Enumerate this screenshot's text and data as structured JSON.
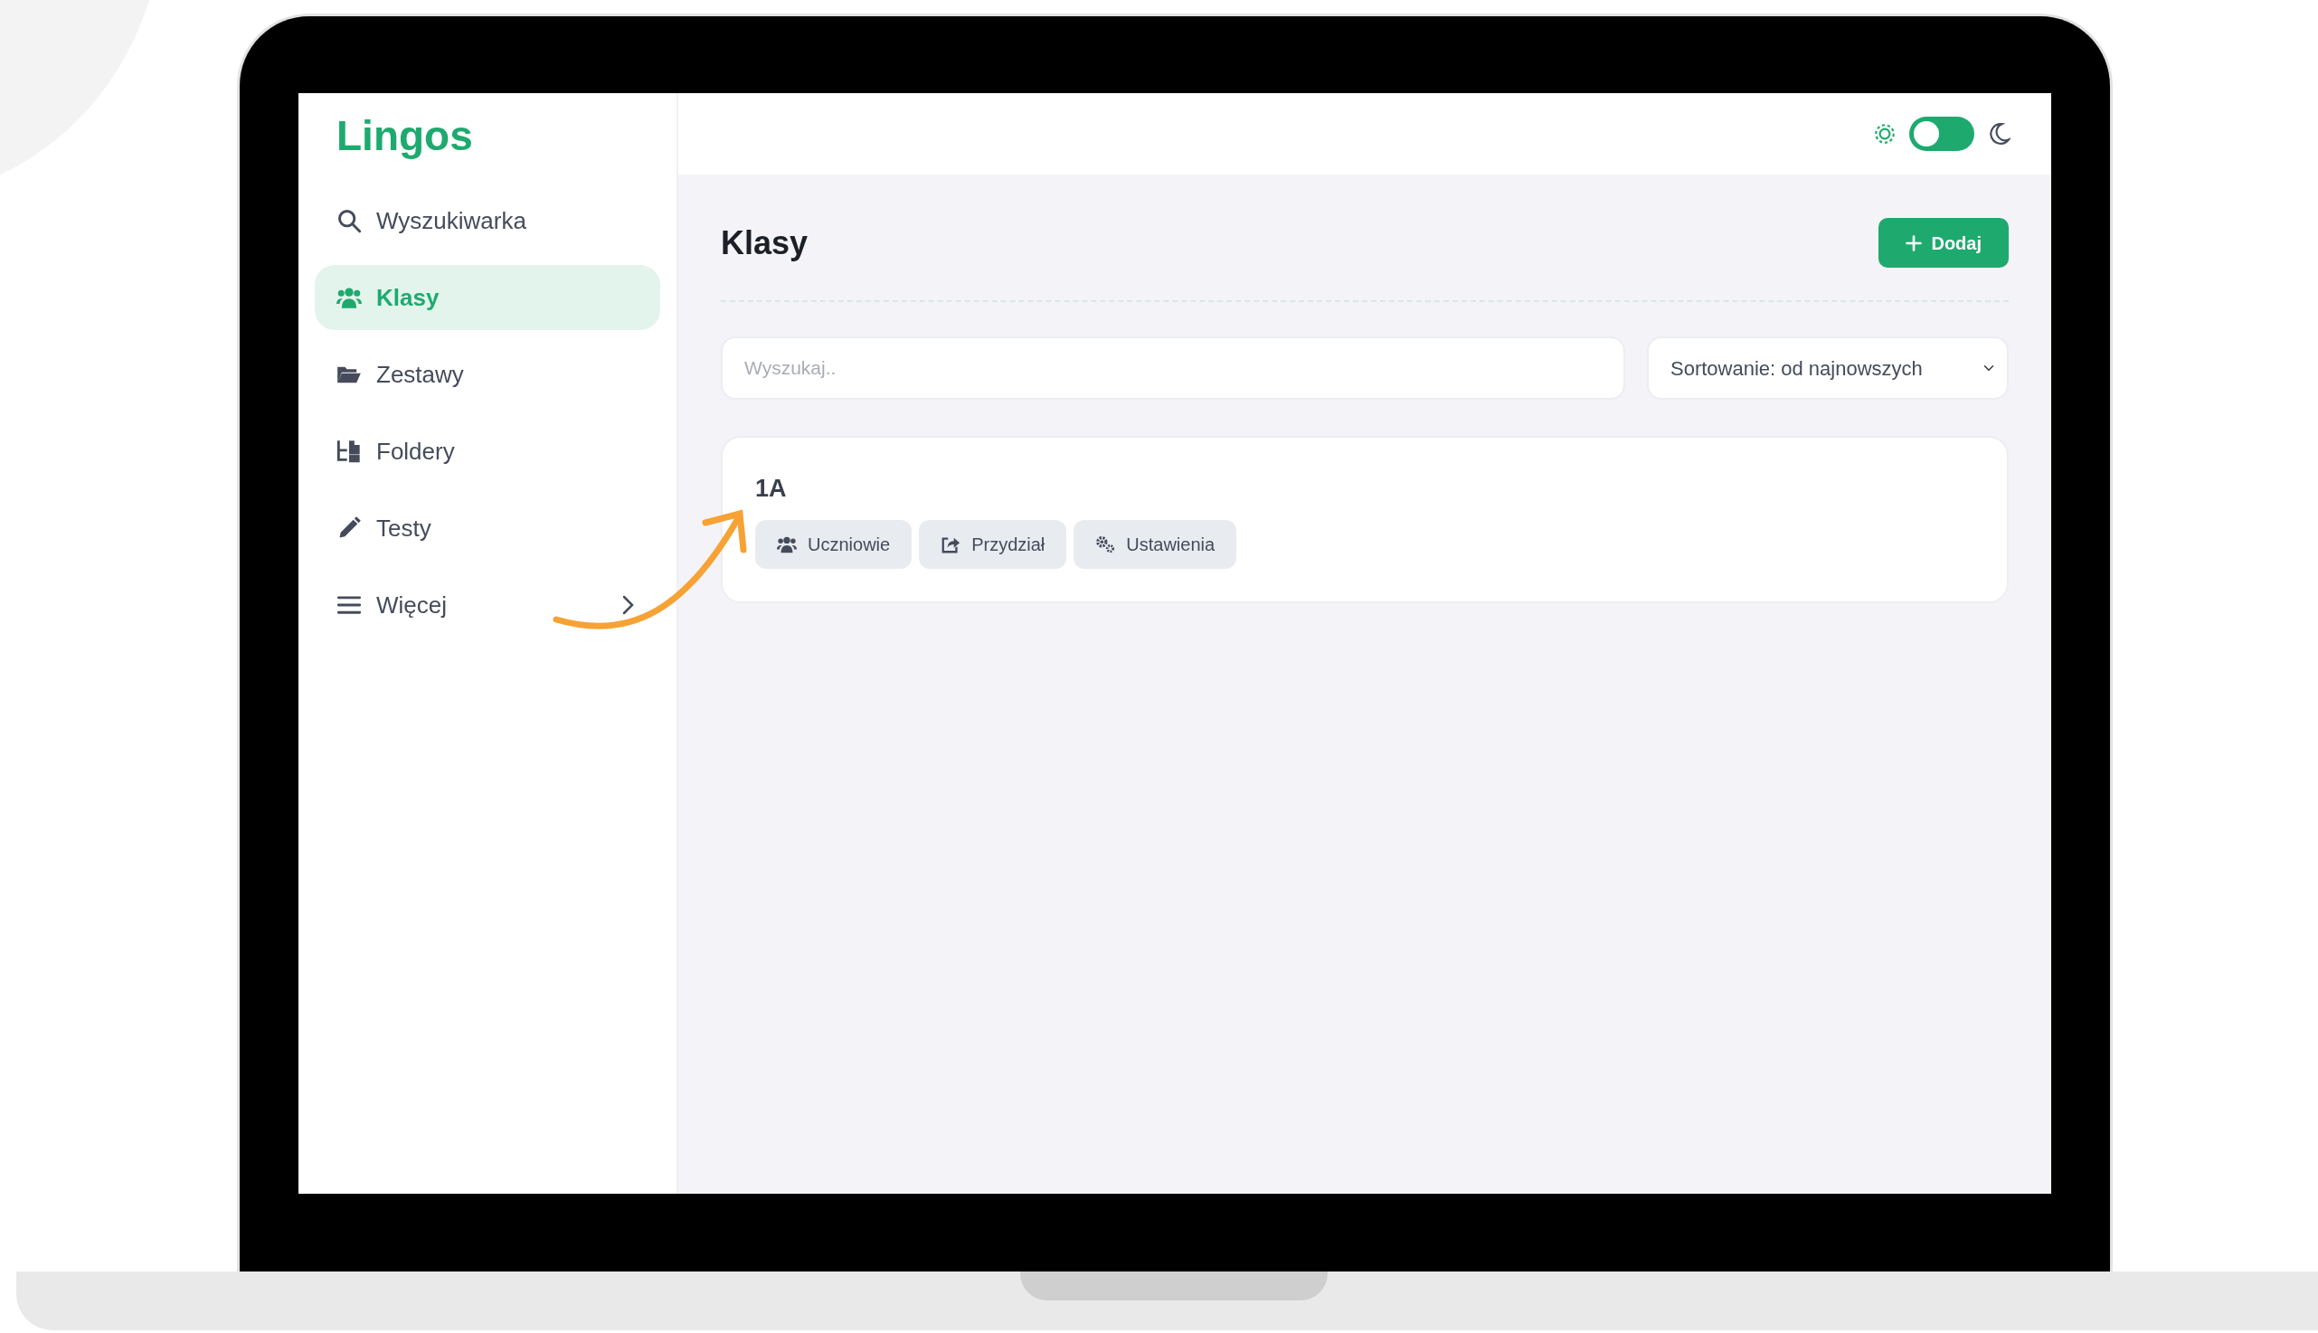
{
  "logo": "Lingos",
  "sidebar": {
    "items": [
      {
        "label": "Wyszukiwarka",
        "selected": false,
        "submenu": false
      },
      {
        "label": "Klasy",
        "selected": true,
        "submenu": false
      },
      {
        "label": "Zestawy",
        "selected": false,
        "submenu": false
      },
      {
        "label": "Foldery",
        "selected": false,
        "submenu": false
      },
      {
        "label": "Testy",
        "selected": false,
        "submenu": false
      },
      {
        "label": "Więcej",
        "selected": false,
        "submenu": true
      }
    ]
  },
  "header": {
    "dark_mode": false
  },
  "page": {
    "title": "Klasy",
    "add_button": "Dodaj",
    "search": {
      "placeholder": "Wyszukaj.."
    },
    "sort": {
      "value": "Sortowanie: od najnowszych"
    }
  },
  "classes": [
    {
      "name": "1A",
      "actions": [
        {
          "label": "Uczniowie"
        },
        {
          "label": "Przydział"
        },
        {
          "label": "Ustawienia"
        }
      ]
    }
  ]
}
